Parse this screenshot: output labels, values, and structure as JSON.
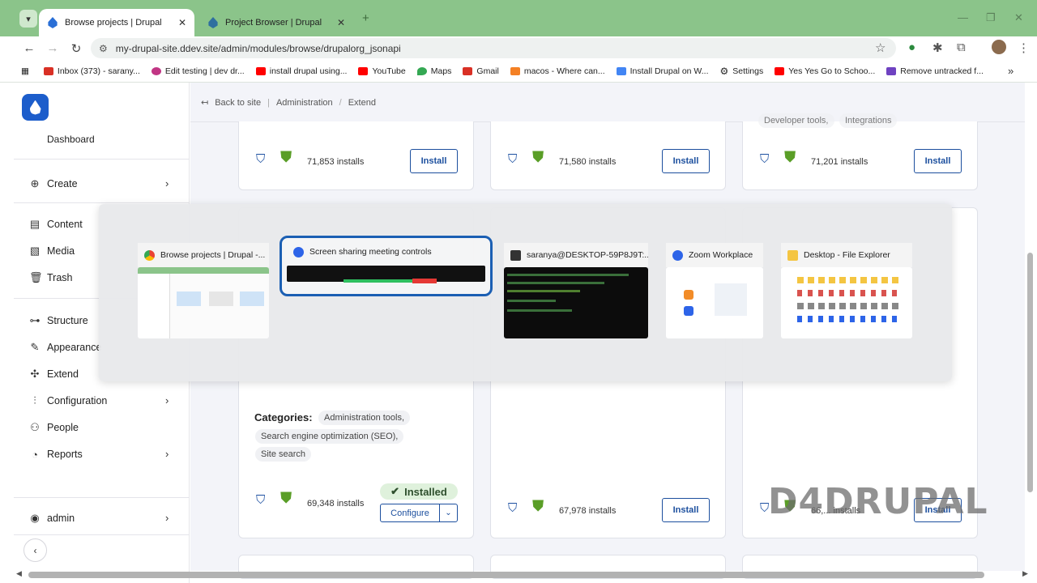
{
  "browser": {
    "tabs": [
      {
        "title": "Browse projects | Drupal",
        "active": true
      },
      {
        "title": "Project Browser | Drupal",
        "active": false
      }
    ],
    "new_tab": "+",
    "close": "✕",
    "url": "my-drupal-site.ddev.site/admin/modules/browse/drupalorg_jsonapi",
    "bookmarks": [
      {
        "label": "Inbox (373) - sarany...",
        "color": "#d93025"
      },
      {
        "label": "Edit testing | dev dr...",
        "color": "#c13584"
      },
      {
        "label": "install drupal using...",
        "color": "#ff0000"
      },
      {
        "label": "YouTube",
        "color": "#ff0000"
      },
      {
        "label": "Maps",
        "color": "#34a853"
      },
      {
        "label": "Gmail",
        "color": "#d93025"
      },
      {
        "label": "macos - Where can...",
        "color": "#f48024"
      },
      {
        "label": "Install Drupal on W...",
        "color": "#4285f4"
      },
      {
        "label": "Settings",
        "color": "#444444"
      },
      {
        "label": "Yes Yes Go to Schoo...",
        "color": "#ff0000"
      },
      {
        "label": "Remove untracked f...",
        "color": "#6f42c1"
      }
    ]
  },
  "breadcrumb": {
    "back": "Back to site",
    "items": [
      "Administration",
      "Extend"
    ]
  },
  "sidebar": {
    "dashboard": "Dashboard",
    "items": [
      {
        "label": "Create",
        "icon": "plus-circle-icon",
        "chevron": true
      },
      {
        "label": "Content",
        "icon": "content-icon",
        "chevron": false
      },
      {
        "label": "Media",
        "icon": "media-icon",
        "chevron": false
      },
      {
        "label": "Trash",
        "icon": "trash-icon",
        "chevron": false
      },
      {
        "label": "Structure",
        "icon": "structure-icon",
        "chevron": false
      },
      {
        "label": "Appearance",
        "icon": "brush-icon",
        "chevron": false
      },
      {
        "label": "Extend",
        "icon": "puzzle-icon",
        "chevron": false
      },
      {
        "label": "Configuration",
        "icon": "sliders-icon",
        "chevron": true
      },
      {
        "label": "People",
        "icon": "people-icon",
        "chevron": false
      },
      {
        "label": "Reports",
        "icon": "reports-icon",
        "chevron": true
      }
    ],
    "user": "admin"
  },
  "projects": {
    "top_row": [
      {
        "installs": "71,853 installs",
        "button": "Install"
      },
      {
        "installs": "71,580 installs",
        "button": "Install"
      },
      {
        "installs": "71,201 installs",
        "button": "Install",
        "tags": [
          "Developer tools,",
          "Integrations"
        ]
      }
    ],
    "bottom_row": [
      {
        "categories_label": "Categories:",
        "categories": [
          "Administration tools,",
          "Search engine optimization (SEO),",
          "Site search"
        ],
        "installs": "69,348 installs",
        "status": "Installed",
        "button": "Configure"
      },
      {
        "installs": "67,978 installs",
        "button": "Install"
      },
      {
        "installs": "66,... installs",
        "button": "Install"
      }
    ]
  },
  "task_switcher": {
    "windows": [
      {
        "title": "Browse projects | Drupal -...",
        "icon": "chrome-icon",
        "selected": false
      },
      {
        "title": "Screen sharing meeting controls",
        "icon": "zoom-icon",
        "selected": true
      },
      {
        "title": "saranya@DESKTOP-59P8J9T:...",
        "icon": "terminal-icon",
        "selected": false
      },
      {
        "title": "Zoom Workplace",
        "icon": "zoom-icon",
        "selected": false
      },
      {
        "title": "Desktop - File Explorer",
        "icon": "folder-icon",
        "selected": false
      }
    ]
  },
  "watermark": "D4DRUPAL"
}
